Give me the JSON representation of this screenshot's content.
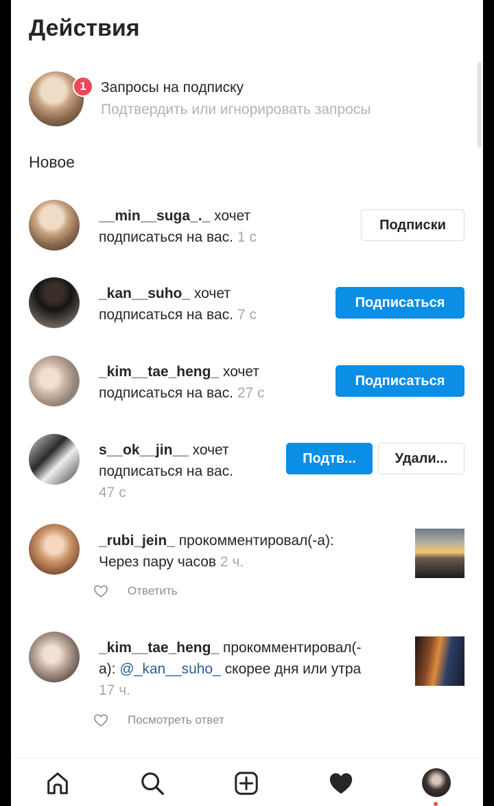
{
  "header": {
    "title": "Действия"
  },
  "requests": {
    "badge_count": "1",
    "title": "Запросы на подписку",
    "subtitle": "Подтвердить или игнорировать запросы"
  },
  "section_new": "Новое",
  "follow_requests": [
    {
      "username": "__min__suga_._",
      "action": "хочет",
      "line2": "подписаться на вас.",
      "time": "1 с",
      "button": "Подписки"
    },
    {
      "username": "_kan__suho_",
      "action": "хочет",
      "line2": "подписаться на вас.",
      "time": "7 с",
      "button": "Подписаться"
    },
    {
      "username": "_kim__tae_heng_",
      "action": "хочет",
      "line2": "подписаться на вас.",
      "time": "27 с",
      "button": "Подписаться"
    },
    {
      "username": "s__ok__jin__",
      "action": "хочет",
      "line2": "подписаться на вас.",
      "time": "47 с",
      "confirm_button": "Подтв...",
      "delete_button": "Удали..."
    }
  ],
  "comments": [
    {
      "username": "_rubi_jein_",
      "action": "прокомментировал(-а):",
      "text": "Через пару часов",
      "time": "2 ч.",
      "reply_label": "Ответить"
    },
    {
      "username": "_kim__tae_heng_",
      "action": "прокомментировал(-",
      "line2_prefix": "а):",
      "mention": "@_kan__suho_",
      "text": "скорее дня или утра",
      "time": "17 ч.",
      "reply_label": "Посмотреть ответ"
    }
  ],
  "tabbar": {
    "icons": [
      "home-icon",
      "search-icon",
      "add-post-icon",
      "activity-heart-icon",
      "profile-avatar"
    ]
  },
  "colors": {
    "primary_blue": "#0a8ee6",
    "badge_red": "#ed4956",
    "secondary_text": "#a8a8a8",
    "mention": "#2c5d94"
  }
}
